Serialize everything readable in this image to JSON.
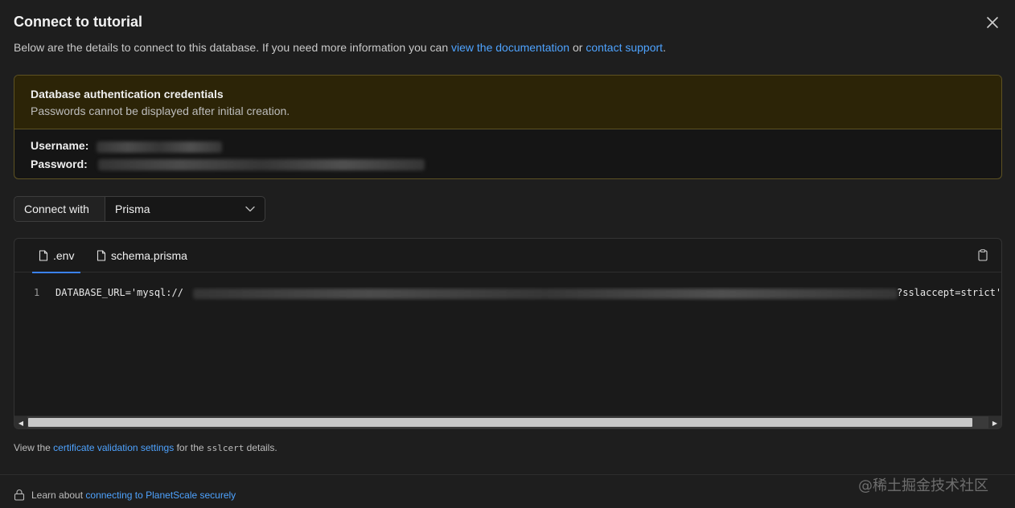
{
  "modal": {
    "title": "Connect to tutorial",
    "intro": {
      "text_before": "Below are the details to connect to this database. If you need more information you can",
      "docs_link": "view the documentation",
      "middle": "or",
      "support_link": "contact support",
      "end": "."
    }
  },
  "credentials": {
    "title": "Database authentication credentials",
    "subtitle": "Passwords cannot be displayed after initial creation.",
    "username_label": "Username:",
    "password_label": "Password:"
  },
  "connect": {
    "label": "Connect with",
    "selected": "Prisma"
  },
  "code": {
    "tabs": [
      {
        "label": ".env",
        "active": true
      },
      {
        "label": "schema.prisma",
        "active": false
      }
    ],
    "line_number": "1",
    "line_prefix": "DATABASE_URL='mysql://",
    "line_suffix": "?sslaccept=strict'"
  },
  "cert_note": {
    "before": "View the",
    "link": "certificate validation settings",
    "middle": "for the",
    "code": "sslcert",
    "after": "details."
  },
  "footer": {
    "before": "Learn about",
    "link": "connecting to PlanetScale securely"
  },
  "watermark": "@稀土掘金技术社区",
  "colors": {
    "background": "#1e1e1e",
    "link": "#4ea3ff",
    "warning_bg": "#2c2407",
    "warning_border": "#5e5222",
    "active_tab": "#3b82f6"
  }
}
